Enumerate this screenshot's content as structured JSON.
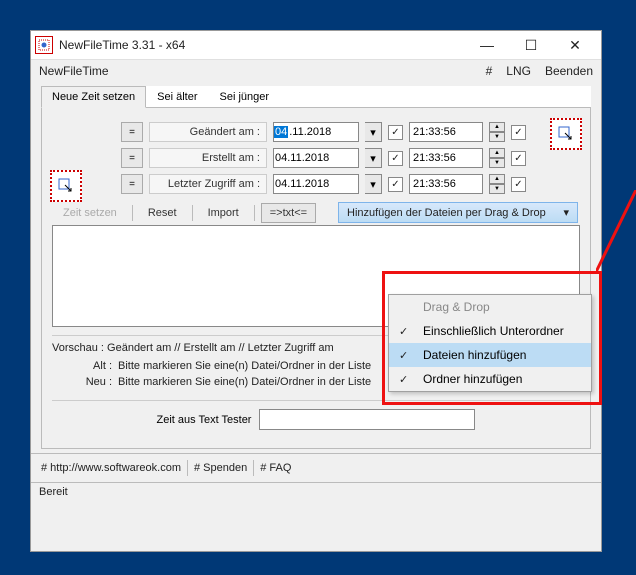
{
  "window": {
    "title": "NewFileTime 3.31 - x64",
    "app_name": "NewFileTime",
    "menu": {
      "hash": "#",
      "lng": "LNG",
      "exit": "Beenden"
    },
    "sys": {
      "min": "—",
      "max": "☐",
      "close": "✕"
    }
  },
  "tabs": {
    "set_new": "Neue Zeit setzen",
    "older": "Sei älter",
    "younger": "Sei jünger"
  },
  "rows": {
    "eq": "=",
    "modified": "Geändert am :",
    "created": "Erstellt am :",
    "accessed": "Letzter Zugriff am :",
    "date_day": "04",
    "date_rest": ".11.2018",
    "date_full": "04.11.2018",
    "time": "21:33:56",
    "check": "✓",
    "drop": "▾",
    "up": "▲",
    "down": "▼"
  },
  "toolbar": {
    "set": "Zeit setzen",
    "reset": "Reset",
    "import": "Import",
    "txt": "=>txt<=",
    "dropdown": "Hinzufügen der Dateien per Drag & Drop",
    "drop": "▾"
  },
  "menu": {
    "header": "Drag & Drop",
    "opt1": "Einschließlich Unterordner",
    "opt2": "Dateien hinzufügen",
    "opt3": "Ordner hinzufügen",
    "check": "✓"
  },
  "preview": {
    "header": "Vorschau :    Geändert am    //    Erstellt am    //    Letzter Zugriff am",
    "alt": "Alt :",
    "neu": "Neu :",
    "msg": "Bitte markieren Sie eine(n) Datei/Ordner in der Liste"
  },
  "tester": {
    "label": "Zeit aus Text Tester"
  },
  "footer": {
    "link1": "# http://www.softwareok.com",
    "link2": "# Spenden",
    "link3": "# FAQ"
  },
  "status": "Bereit"
}
